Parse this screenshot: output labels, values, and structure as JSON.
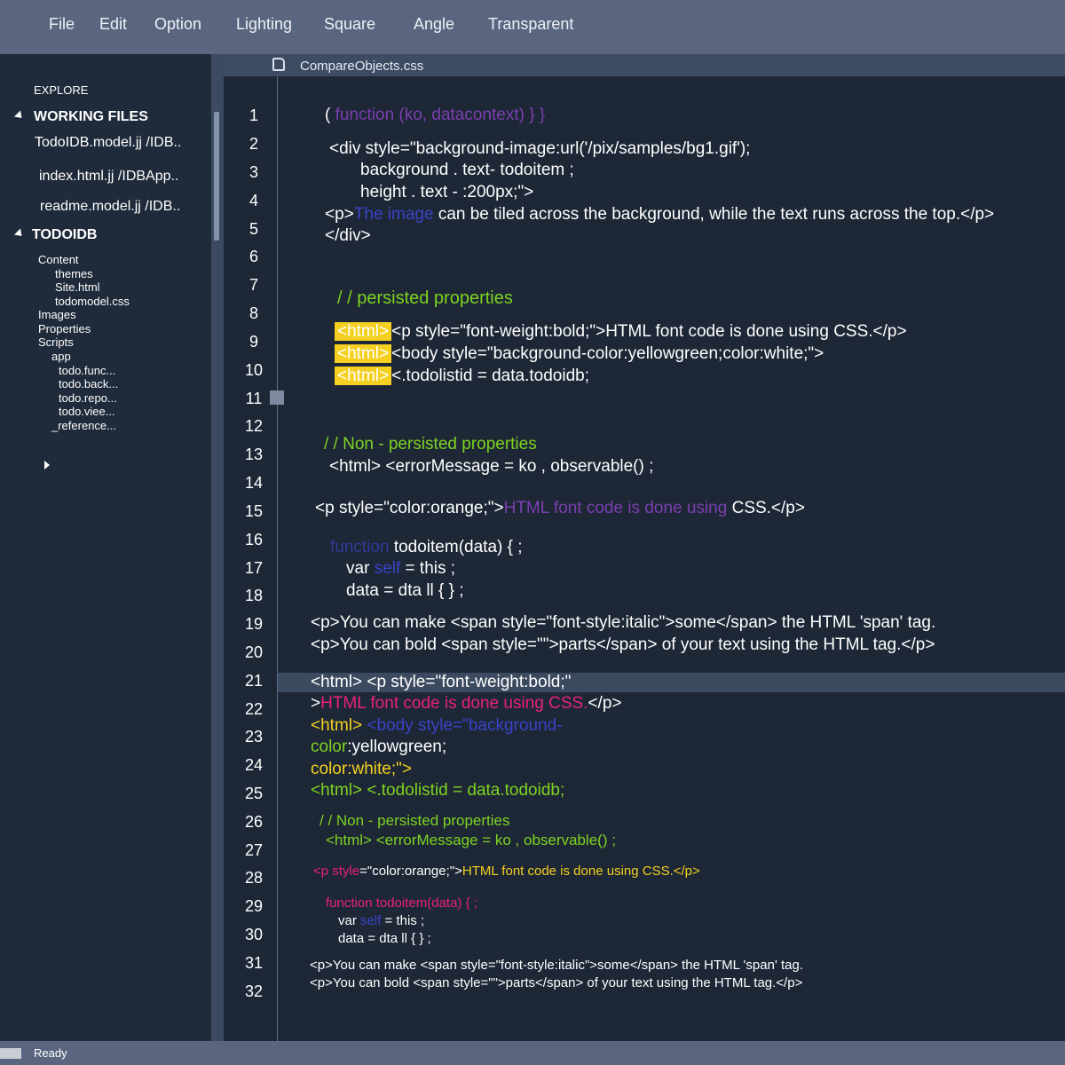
{
  "menu": [
    "File",
    "Edit",
    "Option",
    "Lighting",
    "Square",
    "Angle",
    "Transparent"
  ],
  "sidebar": {
    "explore_label": "EXPLORE",
    "working_files_label": "WORKING FILES",
    "working_files": [
      "TodoIDB.model.jj  /IDB..",
      "index.html.jj  /IDBApp..",
      "readme.model.jj  /IDB.."
    ],
    "project_label": "TODOIDB",
    "tree": [
      "Content",
      "themes",
      "Site.html",
      "todomodel.css",
      "Images",
      "Properties",
      "Scripts",
      "app",
      "todo.func...",
      "todo.back...",
      "todo.repo...",
      "todo.viee...",
      "_reference..."
    ]
  },
  "tab": {
    "filename": "CompareObjects.css"
  },
  "line_numbers": [
    "1",
    "2",
    "3",
    "4",
    "5",
    "6",
    "7",
    "8",
    "9",
    "10",
    "11",
    "12",
    "13",
    "14",
    "15",
    "16",
    "17",
    "18",
    "19",
    "20",
    "21",
    "22",
    "23",
    "24",
    "25",
    "26",
    "27",
    "28",
    "29",
    "30",
    "31",
    "32"
  ],
  "code": {
    "l1": [
      "( ",
      "function  (ko, datacontext)  } }"
    ],
    "l2": "<div style=\"background-image:url('/pix/samples/bg1.gif');",
    "l3": "background . text- todoitem ;",
    "l4": "height . text - :200px;\">",
    "l5": [
      "<p>",
      "The image",
      " can be tiled across the background, while the text runs across the top.</p>"
    ],
    "l6": "</div>",
    "comment1": "/ /  persisted properties",
    "hl_tag": "<html>",
    "l8": "<p style=\"font-weight:bold;\">HTML font code is done using CSS.</p>",
    "l9": "<body style=\"background-color:yellowgreen;color:white;\">",
    "l10": "<.todolistid = data.todoidb;",
    "comment2": "/ / Non - persisted properties",
    "l13": "<html> <errorMessage = ko , observable() ;",
    "l15": [
      "<p style=\"color:orange;\">",
      "HTML font code is done using",
      " CSS.</p>"
    ],
    "l16": [
      "function",
      "  todoitem(data) { ;"
    ],
    "l17": [
      "var  ",
      "self",
      " = this ;"
    ],
    "l18": "data = dta  ll { } ;",
    "l19": "<p>You can make <span style=\"font-style:italic\">some</span> the HTML 'span' tag.",
    "l20": "<p>You can bold <span style=\"\">parts</span> of your text using the HTML tag.</p>",
    "l21": "<html> <p style=\"font-weight:bold;\"",
    "l22": [
      ">",
      "HTML font code is done using CSS.",
      "</p>"
    ],
    "l23": [
      "<html> ",
      "<body style=\"background-"
    ],
    "l24": [
      "color",
      ":yellowgreen;"
    ],
    "l25": [
      "color",
      ":white;\">"
    ],
    "l26": "<html> <.todolistid = data.todoidb;",
    "l27": "/ / Non - persisted properties",
    "l28": "<html> <errorMessage = ko , observable() ;",
    "l29": [
      "<p style",
      "=\"color:orange;\">",
      "HTML font code is done using CSS.</p>"
    ],
    "l30": "function  todoitem(data) { ;",
    "l31": [
      "var  ",
      "self",
      " = this ;"
    ],
    "l32": "data = dta  ll { } ;",
    "l33": "<p>You can make <span style=\"font-style:italic\">some</span> the HTML 'span' tag.",
    "l34": "<p>You can bold <span style=\"\">parts</span> of your text using the HTML tag.</p>"
  },
  "status": {
    "text": "Ready"
  },
  "colors": {
    "keyword_purple": "#7b3fb0",
    "keyword_blue": "#3a44c8",
    "comment_green": "#7ed321",
    "pink": "#e8227a",
    "yellow": "#f5d020",
    "highlight_yellow": "#f5d020"
  }
}
